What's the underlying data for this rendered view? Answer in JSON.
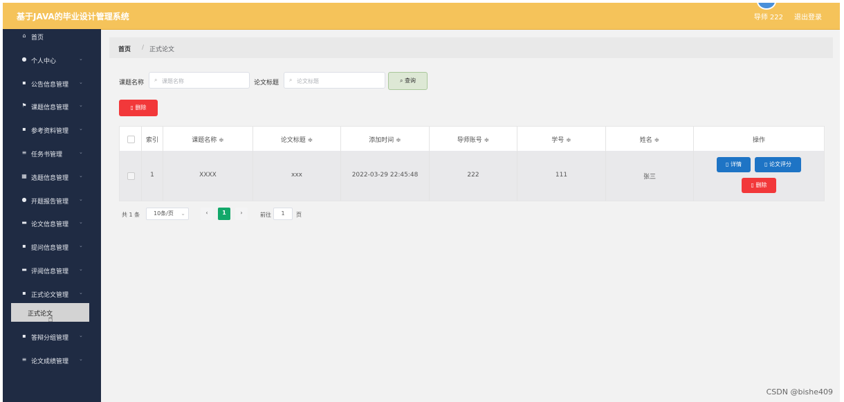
{
  "header": {
    "title": "基于JAVA的毕业设计管理系统",
    "user": "导师 222",
    "logout": "退出登录"
  },
  "sidebar": {
    "items": [
      {
        "icon": "⌂",
        "label": "首页",
        "chevron": ""
      },
      {
        "icon": "●",
        "label": "个人中心",
        "chevron": "⌄"
      },
      {
        "icon": "▪",
        "label": "公告信息管理",
        "chevron": "⌄"
      },
      {
        "icon": "⚑",
        "label": "课题信息管理",
        "chevron": "⌄"
      },
      {
        "icon": "▪",
        "label": "参考资料管理",
        "chevron": "⌄"
      },
      {
        "icon": "≡",
        "label": "任务书管理",
        "chevron": "⌄"
      },
      {
        "icon": "▦",
        "label": "选题信息管理",
        "chevron": "⌄"
      },
      {
        "icon": "●",
        "label": "开题报告管理",
        "chevron": "⌄"
      },
      {
        "icon": "▬",
        "label": "论文信息管理",
        "chevron": "⌄"
      },
      {
        "icon": "▪",
        "label": "提问信息管理",
        "chevron": "⌄"
      },
      {
        "icon": "▬",
        "label": "评阅信息管理",
        "chevron": "⌄"
      },
      {
        "icon": "▪",
        "label": "正式论文管理",
        "chevron": "⌄"
      },
      {
        "icon": "▪",
        "label": "答辩分组管理",
        "chevron": "⌄"
      },
      {
        "icon": "≡",
        "label": "论文成绩管理",
        "chevron": "⌄"
      }
    ],
    "sub_item": "正式论文"
  },
  "breadcrumb": {
    "home": "首页",
    "sep": "/",
    "current": "正式论文"
  },
  "search": {
    "label1": "课题名称",
    "placeholder1": "课题名称",
    "label2": "论文标题",
    "placeholder2": "论文标题",
    "query_label": "查询",
    "search_icon": "⌕"
  },
  "toolbar": {
    "delete_label": "删除"
  },
  "table": {
    "headers": [
      "索引",
      "课题名称 ≑",
      "论文标题 ≑",
      "添加时间 ≑",
      "导师账号 ≑",
      "学号 ≑",
      "姓名 ≑",
      "操作"
    ],
    "rows": [
      {
        "index": "1",
        "topic": "XXXX",
        "title": "xxx",
        "time": "2022-03-29 22:45:48",
        "teacher": "222",
        "student_no": "111",
        "name": "张三"
      }
    ],
    "actions": {
      "detail": "详情",
      "score": "论文评分",
      "delete": "删除"
    }
  },
  "pagination": {
    "total": "共 1 条",
    "page_size": "10条/页",
    "prev": "‹",
    "page": "1",
    "next": "›",
    "goto_label": "前往",
    "goto_value": "1",
    "goto_suffix": "页"
  },
  "watermark": "CSDN @bishe409",
  "colors": {
    "header": "#f5c35a",
    "sidebar": "#1f2b43",
    "primary": "#1e74c5",
    "danger": "#f2383a",
    "active_page": "#13a86a"
  }
}
